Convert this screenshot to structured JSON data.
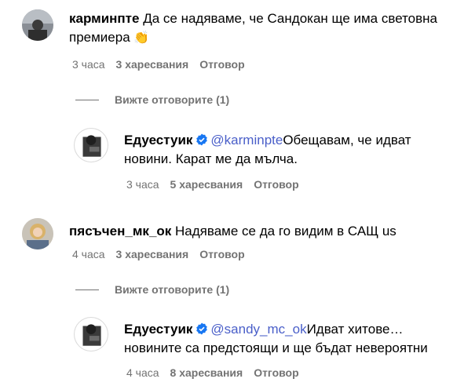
{
  "comments": [
    {
      "username": "карминпте",
      "text": "Да се надяваме, че Сандокан ще има световна премиера",
      "emoji": "👏",
      "time": "3 часа",
      "likes": "3 харесвания",
      "reply": "Отговор",
      "view_replies": "Вижте отговорите (1)",
      "reply_item": {
        "username": "Едуестуик",
        "mention": "@karminpte",
        "text": "Обещавам, че идват новини. Карат ме да мълча.",
        "time": "3 часа",
        "likes": "5 харесвания",
        "reply": "Отговор"
      }
    },
    {
      "username": "пясъчен_мк_ок",
      "text": "Надяваме се да го видим в САЩ us",
      "time": "4 часа",
      "likes": "3 харесвания",
      "reply": "Отговор",
      "view_replies": "Вижте отговорите (1)",
      "reply_item": {
        "username": "Едуестуик",
        "mention": "@sandy_mc_ok",
        "text": "Идват хитове… новините са предстоящи и ще бъдат невероятни",
        "time": "4 часа",
        "likes": "8 харесвания",
        "reply": "Отговор"
      }
    }
  ],
  "colors": {
    "meta": "#737373",
    "mention": "#4a5fc9",
    "verified": "#1877f2"
  },
  "icons": {
    "verified": "verified-badge-icon"
  }
}
